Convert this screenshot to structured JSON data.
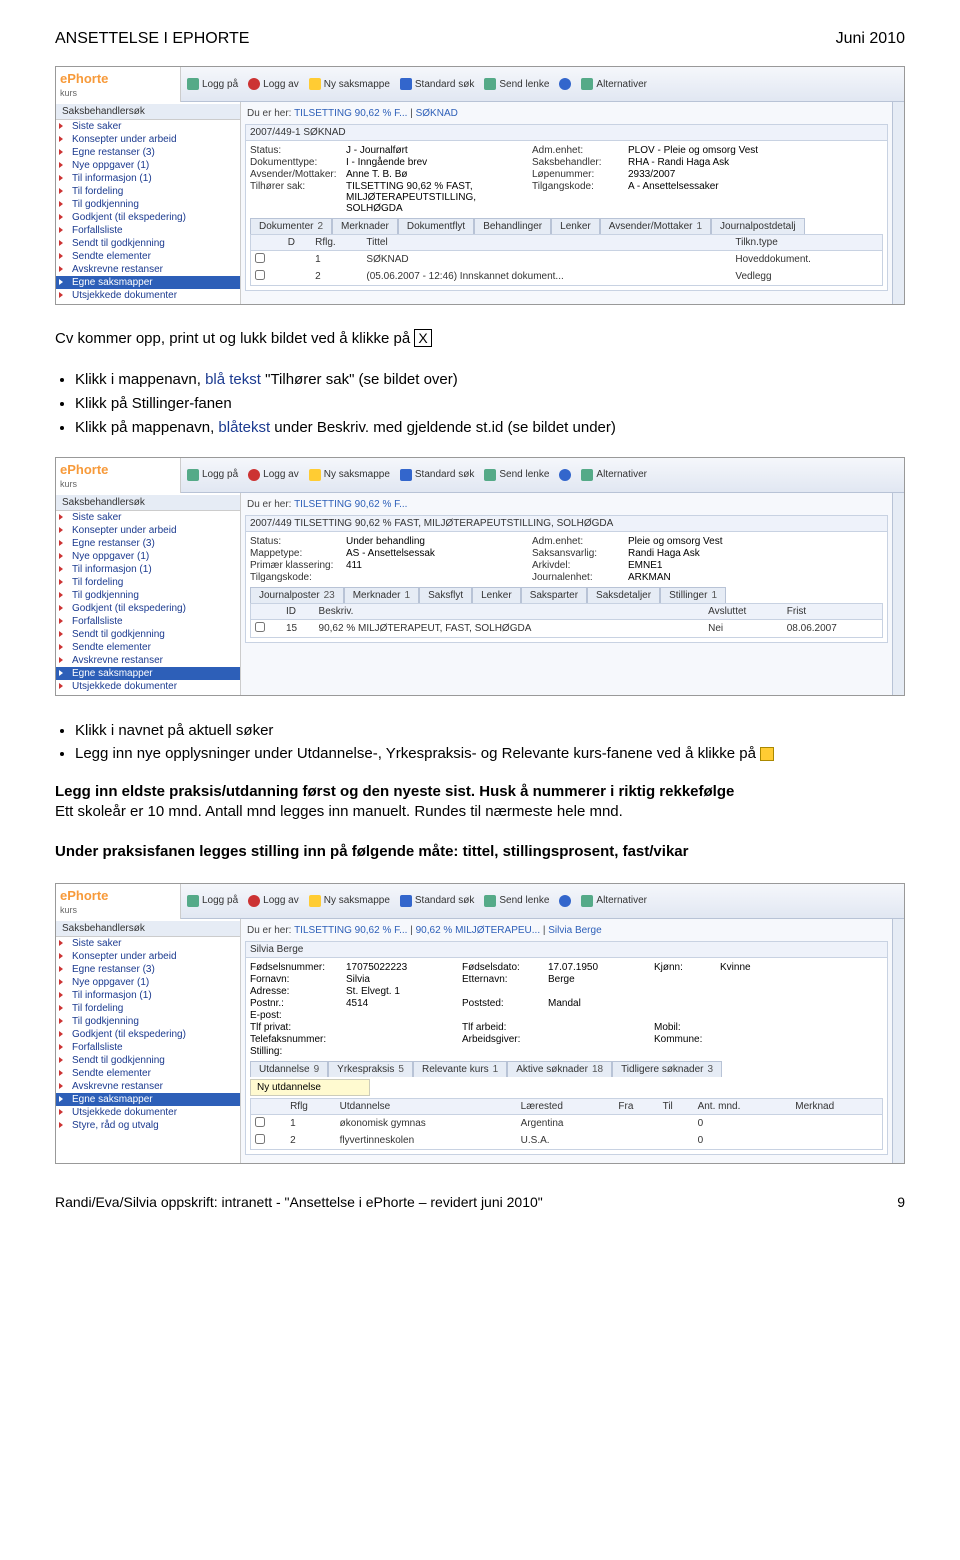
{
  "header": {
    "left": "ANSETTELSE  I  EPHORTE",
    "right": "Juni 2010"
  },
  "toolbar": {
    "loggpa": "Logg på",
    "loggav": "Logg av",
    "nysak": "Ny saksmappe",
    "stdsok": "Standard søk",
    "sendlenke": "Send lenke",
    "help": "",
    "alt": "Alternativer"
  },
  "brand": {
    "name": "ePhorte",
    "sub": "kurs"
  },
  "side_title": "Saksbehandlersøk",
  "side_items": [
    "Siste saker",
    "Konsepter under arbeid",
    "Egne restanser (3)",
    "Nye oppgaver (1)",
    "Til informasjon (1)",
    "Til fordeling",
    "Til godkjenning",
    "Godkjent (til ekspedering)",
    "Forfallsliste",
    "Sendt til godkjenning",
    "Sendte elementer",
    "Avskrevne restanser",
    "Egne saksmapper",
    "Utsjekkede dokumenter"
  ],
  "side_items3_extra": "Styre, råd og utvalg",
  "s1": {
    "crumb_prefix": "Du er her:",
    "crumb_links": [
      "TILSETTING 90,62 % F...",
      "SØKNAD"
    ],
    "panel_title": "2007/449-1 SØKNAD",
    "rows": [
      [
        "Status:",
        "J - Journalført",
        "Adm.enhet:",
        "PLOV - Pleie og omsorg Vest"
      ],
      [
        "Dokumenttype:",
        "I - Inngående brev",
        "Saksbehandler:",
        "RHA - Randi Haga Ask"
      ],
      [
        "Avsender/Mottaker:",
        "Anne T. B. Bø",
        "Løpenummer:",
        "2933/2007"
      ],
      [
        "Tilhører sak:",
        "TILSETTING 90,62 % FAST, MILJØTERAPEUTSTILLING, SOLHØGDA",
        "Tilgangskode:",
        "A - Ansettelsessaker"
      ]
    ],
    "tabs": [
      {
        "l": "Dokumenter",
        "c": "2"
      },
      {
        "l": "Merknader"
      },
      {
        "l": "Dokumentflyt"
      },
      {
        "l": "Behandlinger"
      },
      {
        "l": "Lenker"
      },
      {
        "l": "Avsender/Mottaker",
        "c": "1"
      },
      {
        "l": "Journalpostdetalj"
      }
    ],
    "thead": [
      "",
      "D",
      "Rflg.",
      "Tittel",
      "Tilkn.type"
    ],
    "trows": [
      [
        "",
        "",
        "1",
        "SØKNAD",
        "Hoveddokument."
      ],
      [
        "",
        "",
        "2",
        "(05.06.2007 - 12:46) Innskannet dokument...",
        "Vedlegg"
      ]
    ]
  },
  "p1": {
    "intro": "Cv kommer opp, print ut og lukk bildet ved å klikke på ",
    "x": "X",
    "bullets": [
      {
        "pre": "Klikk i mappenavn, ",
        "blue": "blå tekst",
        "post": " \"Tilhører sak\" (se bildet over)"
      },
      {
        "pre": "Klikk på Stillinger-fanen",
        "blue": "",
        "post": ""
      },
      {
        "pre": "Klikk på mappenavn, ",
        "blue": "blåtekst",
        "post": " under Beskriv. med gjeldende st.id (se bildet under)"
      }
    ]
  },
  "s2": {
    "crumb_prefix": "Du er her:",
    "crumb_links": [
      "TILSETTING 90,62 % F..."
    ],
    "panel_title": "2007/449  TILSETTING 90,62 % FAST, MILJØTERAPEUTSTILLING, SOLHØGDA",
    "rows": [
      [
        "Status:",
        "Under behandling",
        "Adm.enhet:",
        "Pleie og omsorg Vest"
      ],
      [
        "Mappetype:",
        "AS - Ansettelsessak",
        "Saksansvarlig:",
        "Randi Haga Ask"
      ],
      [
        "Primær klassering:",
        "411",
        "Arkivdel:",
        "EMNE1"
      ],
      [
        "Tilgangskode:",
        "",
        "Journalenhet:",
        "ARKMAN"
      ]
    ],
    "tabs": [
      {
        "l": "Journalposter",
        "c": "23"
      },
      {
        "l": "Merknader",
        "c": "1"
      },
      {
        "l": "Saksflyt"
      },
      {
        "l": "Lenker"
      },
      {
        "l": "Saksparter"
      },
      {
        "l": "Saksdetaljer"
      },
      {
        "l": "Stillinger",
        "c": "1"
      }
    ],
    "thead": [
      "",
      "ID",
      "Beskriv.",
      "",
      "Avsluttet",
      "Frist"
    ],
    "trows": [
      [
        "",
        "15",
        "90,62 % MILJØTERAPEUT, FAST, SOLHØGDA",
        "",
        "Nei",
        "08.06.2007"
      ]
    ]
  },
  "p2": {
    "bullets": [
      "Klikk i navnet på aktuell søker",
      "Legg inn nye opplysninger under Utdannelse-, Yrkespraksis- og Relevante kurs-fanene ved å klikke på "
    ],
    "head": "Legg inn eldste praksis/utdanning først og den nyeste sist.  Husk å nummerer  i riktig rekkefølge",
    "line2": "Ett skoleår er 10 mnd.  Antall mnd legges inn manuelt.  Rundes til nærmeste hele mnd.",
    "line3": "Under praksisfanen legges stilling inn på følgende måte: tittel, stillingsprosent, fast/vikar"
  },
  "s3": {
    "crumb_prefix": "Du er her:",
    "crumb_links": [
      "TILSETTING 90,62 % F...",
      "90,62 % MILJØTERAPEU...",
      "Silvia Berge"
    ],
    "panel_title": "Silvia Berge",
    "rows3": [
      [
        "Fødselsnummer:",
        "17075022223",
        "Fødselsdato:",
        "17.07.1950",
        "Kjønn:",
        "Kvinne"
      ],
      [
        "Fornavn:",
        "Silvia",
        "Etternavn:",
        "Berge",
        "",
        ""
      ],
      [
        "Adresse:",
        "St. Elvegt. 1",
        "",
        "",
        "",
        ""
      ],
      [
        "Postnr.:",
        "4514",
        "Poststed:",
        "Mandal",
        "",
        ""
      ],
      [
        "E-post:",
        "",
        "",
        "",
        "",
        ""
      ],
      [
        "Tlf privat:",
        "",
        "Tlf arbeid:",
        "",
        "Mobil:",
        ""
      ],
      [
        "Telefaksnummer:",
        "",
        "Arbeidsgiver:",
        "",
        "Kommune:",
        ""
      ],
      [
        "Stilling:",
        "",
        "",
        "",
        "",
        ""
      ]
    ],
    "tabs": [
      {
        "l": "Utdannelse",
        "c": "9"
      },
      {
        "l": "Yrkespraksis",
        "c": "5"
      },
      {
        "l": "Relevante kurs",
        "c": "1"
      },
      {
        "l": "Aktive søknader",
        "c": "18"
      },
      {
        "l": "Tidligere søknader",
        "c": "3"
      }
    ],
    "nyutd": "Ny utdannelse",
    "thead": [
      "",
      "Rflg",
      "Utdannelse",
      "Lærested",
      "Fra",
      "Til",
      "Ant. mnd.",
      "Merknad"
    ],
    "trows": [
      [
        "",
        "1",
        "økonomisk gymnas",
        "Argentina",
        "",
        "",
        "0",
        ""
      ],
      [
        "",
        "2",
        "flyvertinneskolen",
        "U.S.A.",
        "",
        "",
        "0",
        ""
      ]
    ]
  },
  "footer": {
    "left": "Randi/Eva/Silvia  oppskrift: intranett - \"Ansettelse i ePhorte – revidert juni 2010\"",
    "right": "9"
  }
}
